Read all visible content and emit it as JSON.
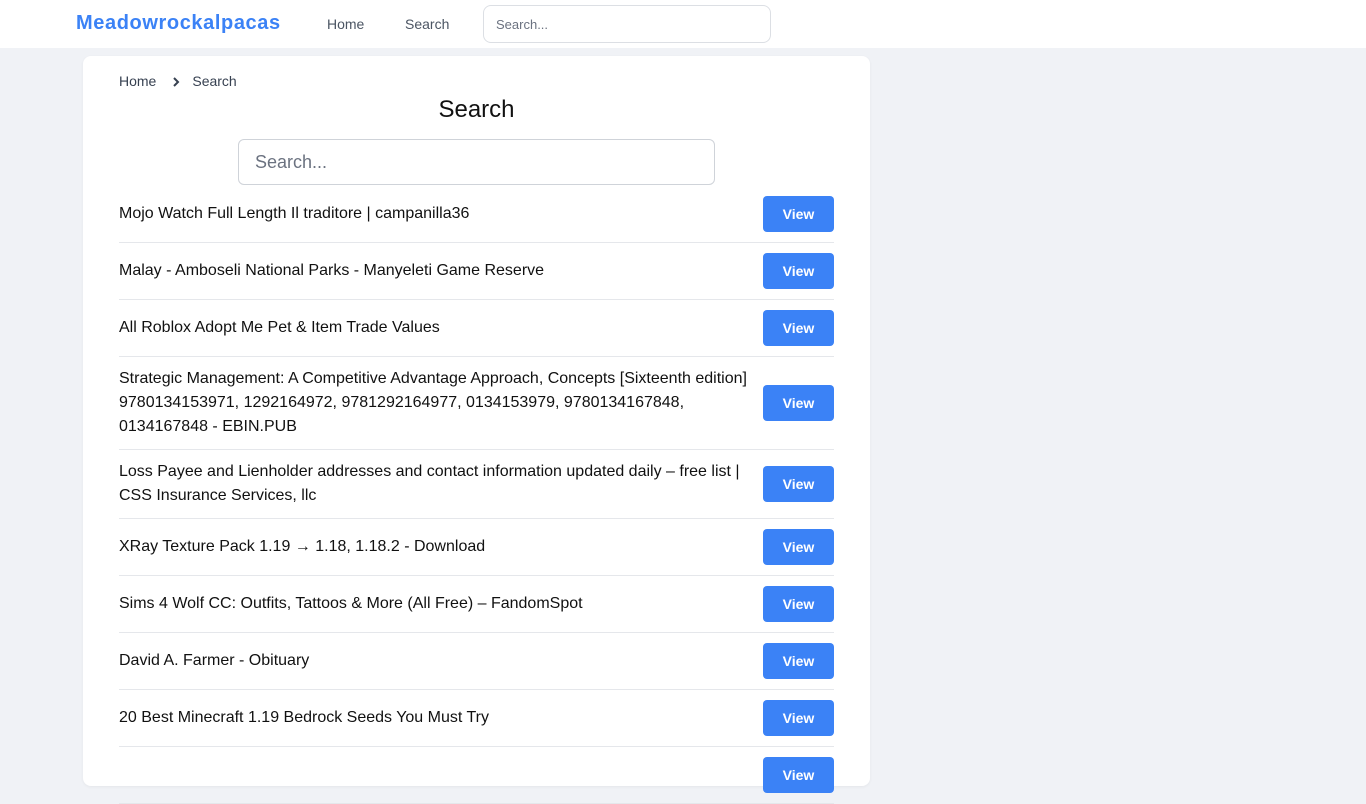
{
  "header": {
    "brand": "Meadowrockalpacas",
    "nav": [
      {
        "label": "Home"
      },
      {
        "label": "Search"
      }
    ],
    "search_placeholder": "Search..."
  },
  "breadcrumb": [
    {
      "label": "Home"
    },
    {
      "label": "Search"
    }
  ],
  "page": {
    "title": "Search",
    "search_placeholder": "Search...",
    "search_value": ""
  },
  "results": [
    {
      "title": "Mojo Watch Full Length Il traditore | campanilla36",
      "button": "View"
    },
    {
      "title": "Malay - Amboseli National Parks - Manyeleti Game Reserve",
      "button": "View"
    },
    {
      "title": "All Roblox Adopt Me Pet & Item Trade Values",
      "button": "View"
    },
    {
      "title": "Strategic Management: A Competitive Advantage Approach, Concepts [Sixteenth edition] 9780134153971, 1292164972, 9781292164977, 0134153979, 9780134167848, 0134167848 - EBIN.PUB",
      "button": "View"
    },
    {
      "title": "Loss Payee and Lienholder addresses and contact information updated daily – free list | CSS Insurance Services, llc",
      "button": "View"
    },
    {
      "title": "XRay Texture Pack 1.19 → 1.18, 1.18.2 - Download",
      "button": "View"
    },
    {
      "title": "Sims 4 Wolf CC: Outfits, Tattoos & More (All Free) – FandomSpot",
      "button": "View"
    },
    {
      "title": "David A. Farmer - Obituary",
      "button": "View"
    },
    {
      "title": "20 Best Minecraft 1.19 Bedrock Seeds You Must Try",
      "button": "View"
    },
    {
      "title": "",
      "button": "View"
    }
  ],
  "colors": {
    "accent": "#3b82f6",
    "background": "#f0f2f6"
  }
}
